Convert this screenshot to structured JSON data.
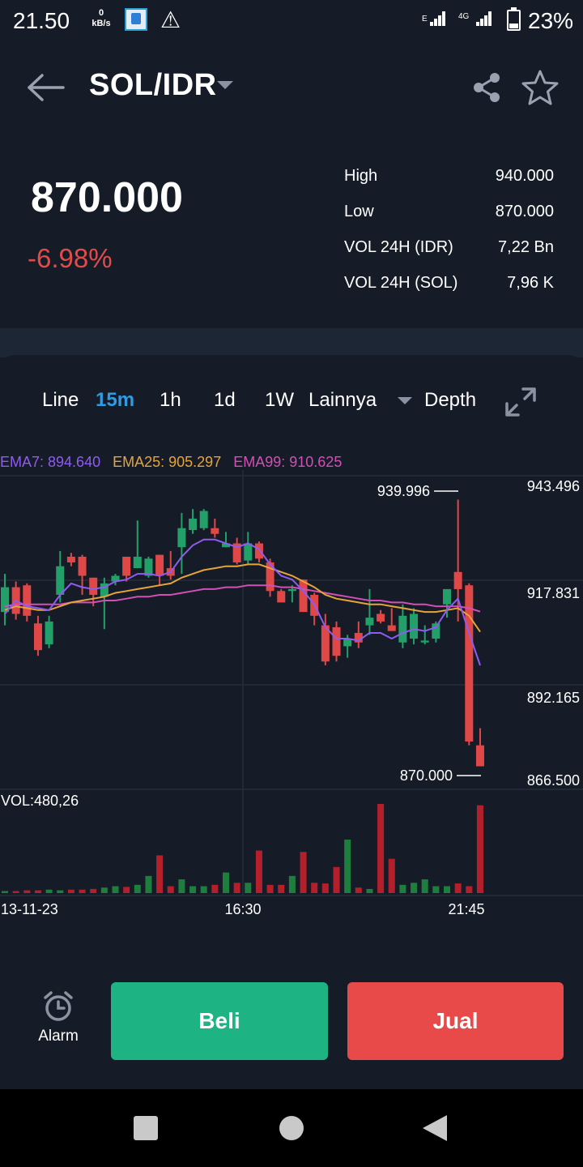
{
  "status_bar": {
    "time": "21.50",
    "net_speed_value": "0",
    "net_speed_unit": "kB/s",
    "network_e": "E",
    "network_4g": "4G",
    "battery": "23%"
  },
  "header": {
    "pair": "SOL/IDR"
  },
  "price": {
    "last": "870.000",
    "change": "-6.98%"
  },
  "stats": [
    {
      "label": "High",
      "value": "940.000"
    },
    {
      "label": "Low",
      "value": "870.000"
    },
    {
      "label": "VOL 24H (IDR)",
      "value": "7,22 Bn"
    },
    {
      "label": "VOL 24H (SOL)",
      "value": "7,96 K"
    }
  ],
  "timeframes": {
    "line": "Line",
    "m15": "15m",
    "h1": "1h",
    "d1": "1d",
    "w1": "1W",
    "more": "Lainnya",
    "depth": "Depth"
  },
  "indicators": {
    "ema7": "EMA7: 894.640",
    "ema25": "EMA25: 905.297",
    "ema99": "EMA99: 910.625",
    "vol": "VOL:480,26"
  },
  "colors": {
    "up": "#23a06a",
    "down": "#e04848",
    "vol_up": "#1e7e3e",
    "vol_down": "#b3202b",
    "ema7": "#8f5bf0",
    "ema25": "#e6a43a",
    "ema99": "#d24fb5",
    "accent": "#2f9be3"
  },
  "chart_data": {
    "type": "candlestick",
    "ylim": [
      866.5,
      943.496
    ],
    "y_ticks": [
      "943.496",
      "917.831",
      "892.165",
      "866.500"
    ],
    "x_ticks": [
      "13-11-23",
      "16:30",
      "21:45"
    ],
    "high_marker": "939.996",
    "low_marker": "870.000",
    "candles": [
      [
        910.5,
        917.0,
        920.5,
        907.0
      ],
      [
        917.0,
        910.0,
        918.5,
        908.5
      ],
      [
        917.5,
        909.5,
        918.0,
        908.0
      ],
      [
        907.5,
        900.5,
        909.5,
        899.0
      ],
      [
        902.0,
        908.0,
        909.5,
        901.0
      ],
      [
        915.0,
        922.5,
        926.5,
        913.0
      ],
      [
        925.0,
        923.5,
        926.0,
        922.5
      ],
      [
        925.0,
        920.0,
        925.5,
        915.0
      ],
      [
        919.5,
        915.0,
        919.5,
        912.0
      ],
      [
        914.5,
        918.0,
        919.5,
        906.0
      ],
      [
        918.5,
        920.0,
        920.5,
        917.5
      ],
      [
        925.0,
        920.0,
        925.0,
        918.5
      ],
      [
        922.0,
        925.0,
        934.5,
        922.5
      ],
      [
        920.0,
        924.5,
        925.0,
        919.5
      ],
      [
        925.5,
        920.0,
        925.5,
        917.5
      ],
      [
        922.0,
        920.0,
        926.5,
        919.0
      ],
      [
        927.5,
        932.5,
        936.5,
        920.5
      ],
      [
        932.0,
        935.0,
        937.5,
        931.0
      ],
      [
        932.5,
        937.0,
        937.5,
        932.0
      ],
      [
        932.5,
        931.0,
        935.0,
        930.0
      ],
      [
        927.5,
        928.5,
        931.5,
        927.5
      ],
      [
        928.5,
        923.5,
        930.0,
        923.0
      ],
      [
        924.0,
        928.5,
        931.5,
        923.0
      ],
      [
        928.5,
        924.5,
        929.0,
        923.5
      ],
      [
        923.5,
        916.0,
        924.5,
        914.5
      ],
      [
        916.0,
        913.0,
        916.5,
        913.0
      ],
      [
        916.0,
        916.5,
        917.5,
        913.0
      ],
      [
        919.0,
        910.5,
        919.0,
        910.5
      ],
      [
        915.0,
        909.5,
        915.5,
        907.0
      ],
      [
        907.0,
        897.5,
        910.0,
        896.5
      ],
      [
        906.5,
        899.0,
        908.0,
        897.5
      ],
      [
        901.5,
        903.5,
        904.5,
        898.5
      ],
      [
        905.0,
        902.5,
        908.0,
        901.0
      ],
      [
        907.0,
        909.0,
        916.5,
        904.5
      ],
      [
        910.0,
        908.0,
        911.0,
        907.5
      ],
      [
        907.0,
        905.5,
        911.5,
        905.5
      ],
      [
        902.5,
        909.5,
        912.5,
        901.0
      ],
      [
        903.5,
        910.0,
        911.5,
        902.0
      ],
      [
        902.5,
        903.0,
        907.0,
        902.0
      ],
      [
        903.5,
        907.5,
        908.0,
        902.5
      ],
      [
        912.5,
        916.5,
        916.5,
        909.0
      ],
      [
        921.0,
        916.5,
        939.996,
        908.0
      ],
      [
        917.5,
        876.5,
        918.0,
        875.5
      ],
      [
        875.5,
        870.0,
        880.0,
        870.0
      ]
    ],
    "ema7": [
      910.0,
      913.5,
      912.0,
      911.5,
      911.0,
      915.0,
      918.0,
      917.0,
      916.5,
      917.0,
      918.5,
      919.0,
      920.5,
      920.5,
      920.0,
      921.0,
      925.0,
      928.0,
      929.5,
      929.5,
      928.5,
      927.5,
      928.5,
      927.0,
      923.0,
      920.0,
      919.0,
      916.0,
      912.5,
      906.5,
      903.5,
      903.5,
      903.0,
      905.0,
      905.0,
      903.5,
      905.0,
      906.0,
      905.5,
      906.5,
      911.0,
      914.0,
      905.0,
      896.5
    ],
    "ema25": [
      911.0,
      912.0,
      911.5,
      911.0,
      911.0,
      912.0,
      913.0,
      913.5,
      914.0,
      914.5,
      915.5,
      916.0,
      916.5,
      917.0,
      917.5,
      918.0,
      919.5,
      920.5,
      921.5,
      922.0,
      922.5,
      922.5,
      923.0,
      923.0,
      922.0,
      921.0,
      920.0,
      918.5,
      917.0,
      915.0,
      914.0,
      913.5,
      913.0,
      912.5,
      912.5,
      912.0,
      911.5,
      911.0,
      910.5,
      910.5,
      911.0,
      911.5,
      909.5,
      905.3
    ],
    "ema99": [
      912.0,
      912.5,
      912.5,
      912.5,
      912.5,
      912.5,
      913.0,
      913.0,
      913.0,
      913.5,
      913.5,
      914.0,
      914.5,
      914.5,
      915.0,
      915.0,
      915.5,
      916.0,
      916.5,
      916.5,
      917.0,
      917.0,
      917.5,
      917.5,
      917.5,
      917.0,
      917.0,
      916.5,
      916.0,
      915.5,
      915.0,
      914.5,
      914.0,
      913.5,
      913.5,
      913.0,
      913.0,
      912.5,
      912.5,
      912.0,
      912.0,
      912.0,
      911.5,
      910.6
    ],
    "volume": [
      3,
      3,
      4,
      4,
      5,
      4,
      5,
      5,
      6,
      8,
      10,
      9,
      12,
      25,
      55,
      10,
      20,
      10,
      10,
      12,
      30,
      15,
      15,
      62,
      12,
      12,
      25,
      60,
      15,
      14,
      38,
      78,
      8,
      6,
      130,
      50,
      12,
      15,
      20,
      10,
      10,
      14,
      10,
      128
    ]
  },
  "actions": {
    "alarm": "Alarm",
    "buy": "Beli",
    "sell": "Jual"
  }
}
